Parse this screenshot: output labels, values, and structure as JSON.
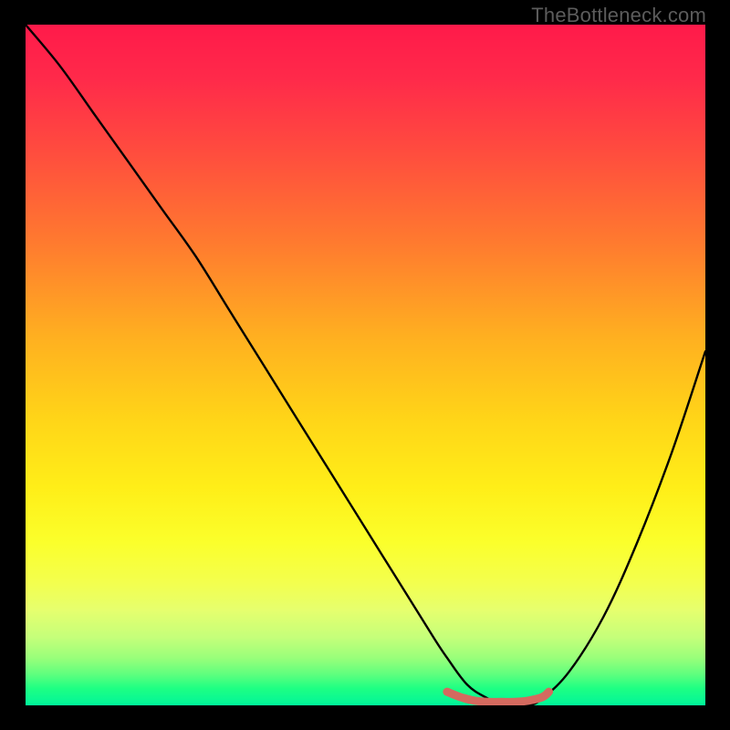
{
  "watermark": "TheBottleneck.com",
  "colors": {
    "background": "#000000",
    "curve": "#000000",
    "marker": "#d46a5f",
    "gradient_top": "#ff1a4a",
    "gradient_bottom": "#00f59a"
  },
  "chart_data": {
    "type": "line",
    "title": "",
    "xlabel": "",
    "ylabel": "",
    "xlim": [
      0,
      100
    ],
    "ylim": [
      0,
      100
    ],
    "grid": false,
    "legend": false,
    "series": [
      {
        "name": "bottleneck-curve",
        "x": [
          0,
          5,
          10,
          15,
          20,
          25,
          30,
          35,
          40,
          45,
          50,
          55,
          60,
          62,
          65,
          68,
          70,
          72,
          74,
          76,
          80,
          85,
          90,
          95,
          100
        ],
        "y": [
          100,
          94,
          87,
          80,
          73,
          66,
          58,
          50,
          42,
          34,
          26,
          18,
          10,
          7,
          3,
          1,
          0,
          0,
          0,
          1,
          5,
          13,
          24,
          37,
          52
        ]
      },
      {
        "name": "optimal-range-marker",
        "x": [
          62,
          64,
          66,
          68,
          70,
          72,
          74,
          76,
          77
        ],
        "y": [
          2.0,
          1.2,
          0.7,
          0.5,
          0.5,
          0.5,
          0.7,
          1.2,
          2.0
        ]
      }
    ],
    "annotations": []
  }
}
